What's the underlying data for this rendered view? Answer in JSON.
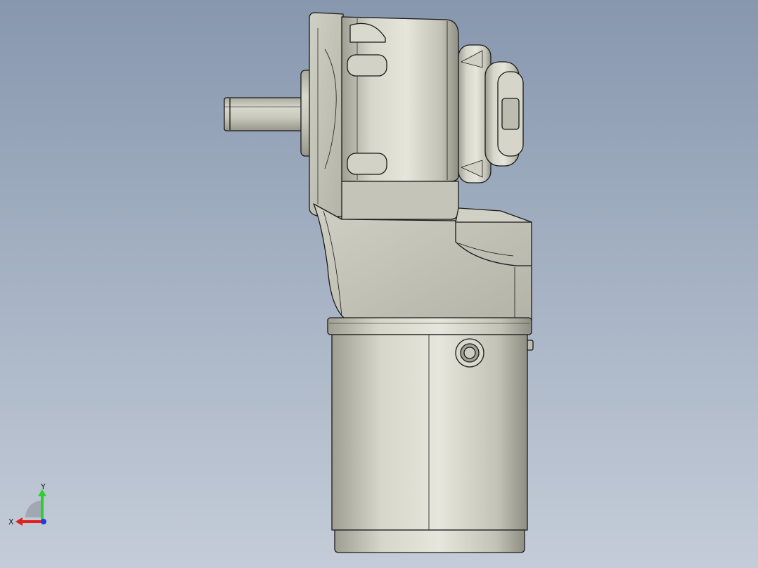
{
  "viewport": {
    "background_top": "#8797ae",
    "background_bottom": "#c4ccd8",
    "model_color": "#c9c9bc",
    "edge_color": "#1a1a1a"
  },
  "triad": {
    "x_label": "X",
    "y_label": "Y",
    "x_color": "#e0201c",
    "y_color": "#2bd12b",
    "z_color": "#1f3fd8"
  }
}
